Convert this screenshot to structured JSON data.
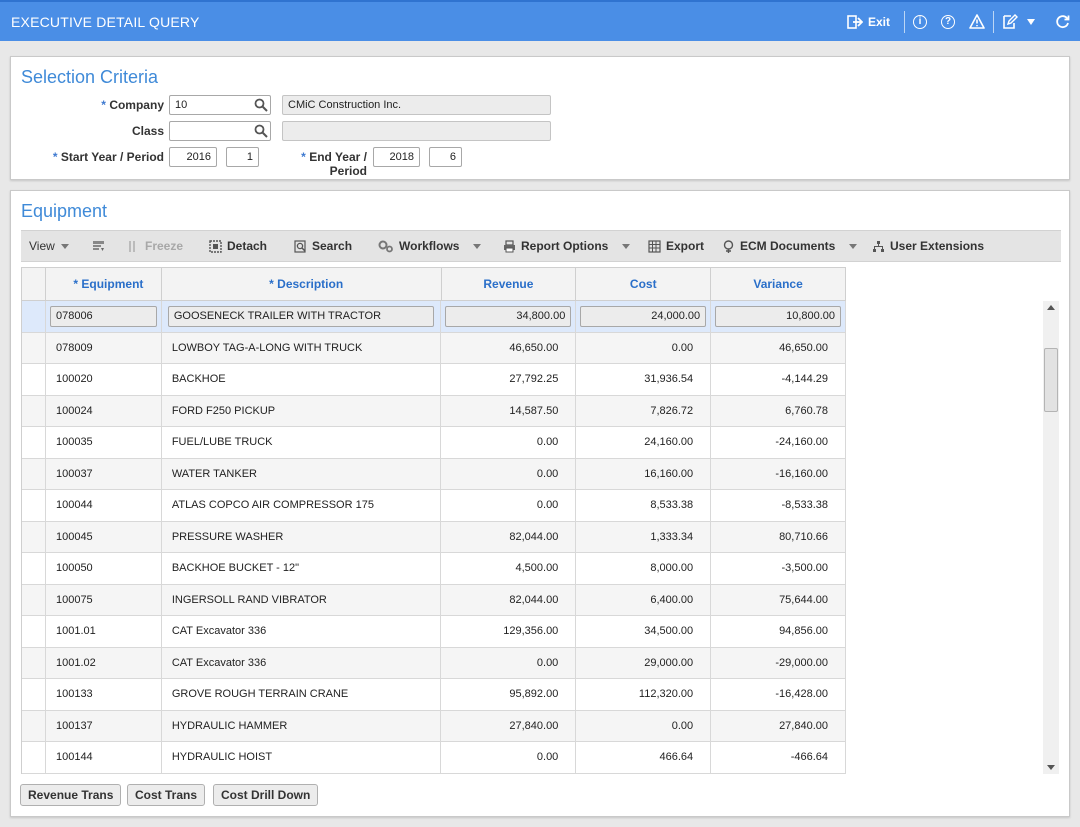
{
  "app": {
    "title": "EXECUTIVE DETAIL QUERY",
    "exit_label": "Exit",
    "accent_color": "#4a8ee6",
    "icons": [
      "exit-icon",
      "info-icon",
      "help-icon",
      "warning-icon",
      "edit-icon",
      "chevron-down-icon",
      "refresh-icon"
    ]
  },
  "criteria": {
    "title": "Selection Criteria",
    "required_mark": "*",
    "company_label": "Company",
    "company_value": "10",
    "company_name": "CMiC Construction Inc.",
    "class_label": "Class",
    "class_value": "",
    "class_name": "",
    "start_label": "Start Year / Period",
    "start_year": "2016",
    "start_period": "1",
    "end_label": "End Year / Period",
    "end_year": "2018",
    "end_period": "6"
  },
  "equipment": {
    "title": "Equipment",
    "toolbar": {
      "view": "View",
      "freeze": "Freeze",
      "detach": "Detach",
      "search": "Search",
      "workflows": "Workflows",
      "report_options": "Report Options",
      "export": "Export",
      "ecm_documents": "ECM Documents",
      "user_extensions": "User Extensions"
    },
    "columns": {
      "equipment": "* Equipment",
      "description": "* Description",
      "revenue": "Revenue",
      "cost": "Cost",
      "variance": "Variance"
    },
    "rows": [
      {
        "equipment": "078006",
        "description": "GOOSENECK TRAILER WITH TRACTOR",
        "revenue": "34,800.00",
        "cost": "24,000.00",
        "variance": "10,800.00"
      },
      {
        "equipment": "078009",
        "description": "LOWBOY TAG-A-LONG WITH TRUCK",
        "revenue": "46,650.00",
        "cost": "0.00",
        "variance": "46,650.00"
      },
      {
        "equipment": "100020",
        "description": "BACKHOE",
        "revenue": "27,792.25",
        "cost": "31,936.54",
        "variance": "-4,144.29"
      },
      {
        "equipment": "100024",
        "description": "FORD F250 PICKUP",
        "revenue": "14,587.50",
        "cost": "7,826.72",
        "variance": "6,760.78"
      },
      {
        "equipment": "100035",
        "description": "FUEL/LUBE TRUCK",
        "revenue": "0.00",
        "cost": "24,160.00",
        "variance": "-24,160.00"
      },
      {
        "equipment": "100037",
        "description": "WATER TANKER",
        "revenue": "0.00",
        "cost": "16,160.00",
        "variance": "-16,160.00"
      },
      {
        "equipment": "100044",
        "description": "ATLAS COPCO AIR COMPRESSOR 175",
        "revenue": "0.00",
        "cost": "8,533.38",
        "variance": "-8,533.38"
      },
      {
        "equipment": "100045",
        "description": "PRESSURE WASHER",
        "revenue": "82,044.00",
        "cost": "1,333.34",
        "variance": "80,710.66"
      },
      {
        "equipment": "100050",
        "description": "BACKHOE BUCKET - 12\"",
        "revenue": "4,500.00",
        "cost": "8,000.00",
        "variance": "-3,500.00"
      },
      {
        "equipment": "100075",
        "description": "INGERSOLL RAND VIBRATOR",
        "revenue": "82,044.00",
        "cost": "6,400.00",
        "variance": "75,644.00"
      },
      {
        "equipment": "1001.01",
        "description": "CAT Excavator 336",
        "revenue": "129,356.00",
        "cost": "34,500.00",
        "variance": "94,856.00"
      },
      {
        "equipment": "1001.02",
        "description": "CAT Excavator 336",
        "revenue": "0.00",
        "cost": "29,000.00",
        "variance": "-29,000.00"
      },
      {
        "equipment": "100133",
        "description": "GROVE ROUGH TERRAIN CRANE",
        "revenue": "95,892.00",
        "cost": "112,320.00",
        "variance": "-16,428.00"
      },
      {
        "equipment": "100137",
        "description": "HYDRAULIC HAMMER",
        "revenue": "27,840.00",
        "cost": "0.00",
        "variance": "27,840.00"
      },
      {
        "equipment": "100144",
        "description": "HYDRAULIC HOIST",
        "revenue": "0.00",
        "cost": "466.64",
        "variance": "-466.64"
      }
    ],
    "buttons": {
      "revenue_trans": "Revenue Trans",
      "cost_trans": "Cost Trans",
      "cost_drill_down": "Cost Drill Down"
    }
  }
}
